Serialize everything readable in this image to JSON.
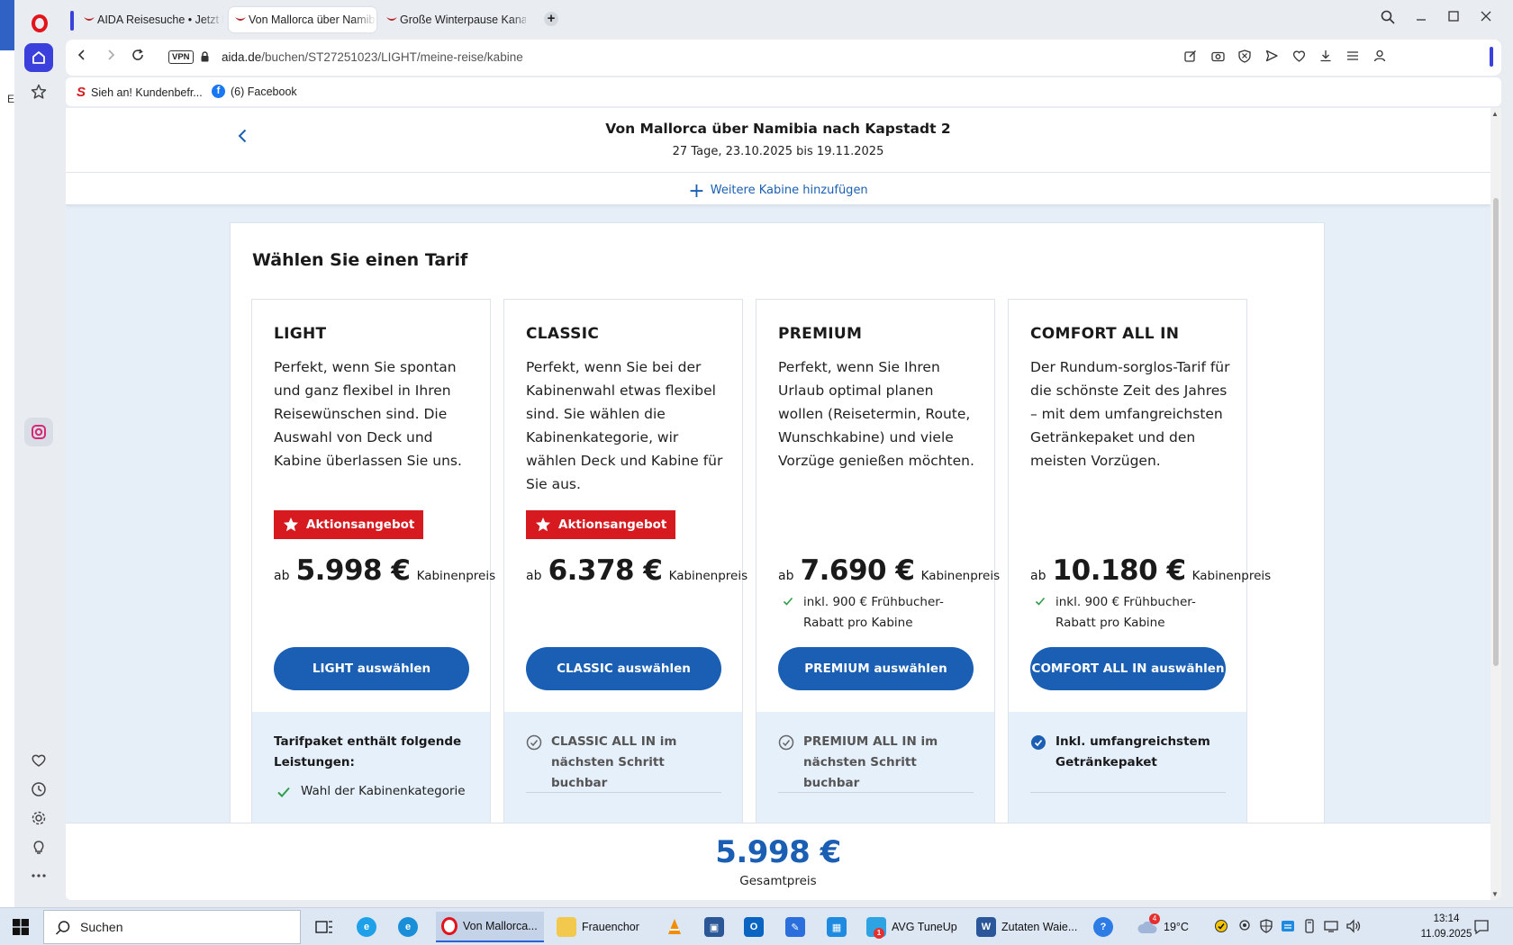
{
  "browser": {
    "tabs": [
      {
        "label": "AIDA Reisesuche • Jetzt Kr",
        "active": false
      },
      {
        "label": "Von Mallorca über Namibi",
        "active": true
      },
      {
        "label": "Große Winterpause Kanar",
        "active": false
      }
    ],
    "url_host": "aida.de",
    "url_path": "/buchen/ST27251023/LIGHT/meine-reise/kabine",
    "vpn_label": "VPN",
    "bookmarks": [
      {
        "label": "Sieh an! Kundenbefr...",
        "icon": "sieh-an-icon"
      },
      {
        "label": "(6) Facebook",
        "icon": "facebook-icon"
      }
    ],
    "left_edge_char": "E"
  },
  "header": {
    "trip_title": "Von Mallorca über Namibia nach Kapstadt 2",
    "trip_dates": "27 Tage, 23.10.2025 bis 19.11.2025",
    "add_cabin_label": "Weitere Kabine hinzufügen"
  },
  "tariffs": {
    "heading": "Wählen Sie einen Tarif",
    "price_prefix": "ab",
    "price_suffix": "Kabinenpreis",
    "cards": [
      {
        "name": "LIGHT",
        "description": "Perfekt, wenn Sie spontan und ganz flexibel in Ihren Reisewünschen sind. Die Auswahl von Deck und Kabine überlassen Sie uns.",
        "badge": "Aktionsangebot",
        "price": "5.998 €",
        "discount": "",
        "button": "LIGHT auswählen",
        "foot_heading": "Tarifpaket enthält folgende Leistungen:",
        "foot_item": "Wahl der Kabinenkategorie"
      },
      {
        "name": "CLASSIC",
        "description": "Perfekt, wenn Sie bei der Kabinenwahl etwas flexibel sind. Sie wählen die Kabinenkategorie, wir wählen Deck und Kabine für Sie aus.",
        "badge": "Aktionsangebot",
        "price": "6.378 €",
        "discount": "",
        "button": "CLASSIC auswählen",
        "foot_incl": "CLASSIC ALL IN im nächsten Schritt buchbar"
      },
      {
        "name": "PREMIUM",
        "description": "Perfekt, wenn Sie Ihren Urlaub optimal planen wollen (Reisetermin, Route, Wunschkabine) und viele Vorzüge genießen möchten.",
        "badge": "",
        "price": "7.690 €",
        "discount": "inkl. 900 € Frühbucher-Rabatt pro Kabine",
        "button": "PREMIUM auswählen",
        "foot_incl": "PREMIUM ALL IN im nächsten Schritt buchbar"
      },
      {
        "name": "COMFORT ALL IN",
        "description": "Der Rundum-sorglos-Tarif für die schönste Zeit des Jahres – mit dem umfangreichsten Getränkepaket und den meisten Vorzügen.",
        "badge": "",
        "price": "10.180 €",
        "discount": "inkl. 900 € Frühbucher-Rabatt pro Kabine",
        "button": "COMFORT ALL IN auswählen",
        "foot_incl": "Inkl. umfangreichstem Getränkepaket"
      }
    ]
  },
  "summary": {
    "total": "5.998 €",
    "total_label": "Gesamtpreis"
  },
  "taskbar": {
    "search_label": "Suchen",
    "items": [
      {
        "label": "Von Mallorca...",
        "icon": "opera-icon"
      },
      {
        "label": "Frauenchor",
        "icon": "folder-icon"
      },
      {
        "label": "AVG TuneUp",
        "icon": "avg-icon"
      },
      {
        "label": "Zutaten Waie...",
        "icon": "word-icon"
      }
    ],
    "weather_temp": "19°C",
    "weather_badge": "4",
    "avg_badge": "1",
    "time": "13:14",
    "date": "11.09.2025"
  },
  "colors": {
    "accent": "#1a5fb4",
    "promo": "#d71920",
    "opera": "#e3121b",
    "sidebar_active": "#3b3fdc"
  }
}
